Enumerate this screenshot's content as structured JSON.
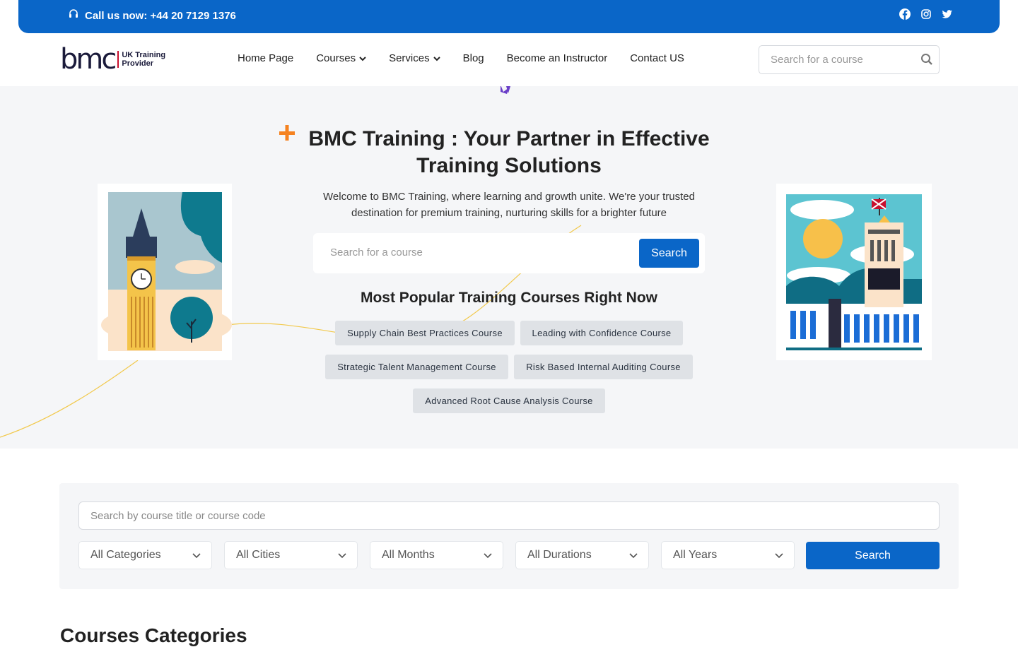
{
  "topbar": {
    "call_text": "Call us now: +44 20 7129 1376",
    "social": [
      "facebook-icon",
      "instagram-icon",
      "twitter-icon"
    ]
  },
  "nav": {
    "logo_mark": "bmc",
    "logo_sub_1": "UK Training",
    "logo_sub_2": "Provider",
    "items": [
      {
        "label": "Home Page"
      },
      {
        "label": "Courses"
      },
      {
        "label": "Services"
      },
      {
        "label": "Blog"
      },
      {
        "label": "Become an Instructor"
      },
      {
        "label": "Contact US"
      }
    ],
    "search_placeholder": "Search for a course"
  },
  "hero": {
    "title": "BMC Training : Your Partner in Effective Training Solutions",
    "lead": "Welcome to BMC Training, where learning and growth unite. We're your trusted destination for premium training, nurturing skills for a brighter future",
    "search_placeholder": "Search for a course",
    "search_button": "Search",
    "popular_title": "Most Popular Training Courses Right Now",
    "chips": [
      "Supply Chain Best Practices Course",
      "Leading with Confidence Course",
      "Strategic Talent Management Course",
      "Risk Based Internal Auditing Course",
      "Advanced Root Cause Analysis Course"
    ]
  },
  "filter": {
    "query_placeholder": "Search by course title or course code",
    "selects": [
      "All Categories",
      "All Cities",
      "All Months",
      "All Durations",
      "All Years"
    ],
    "button": "Search"
  },
  "categories_title": "Courses Categories",
  "colors": {
    "primary": "#0a66c8",
    "accent_orange": "#f58220",
    "hero_bg": "#f5f6f8"
  }
}
